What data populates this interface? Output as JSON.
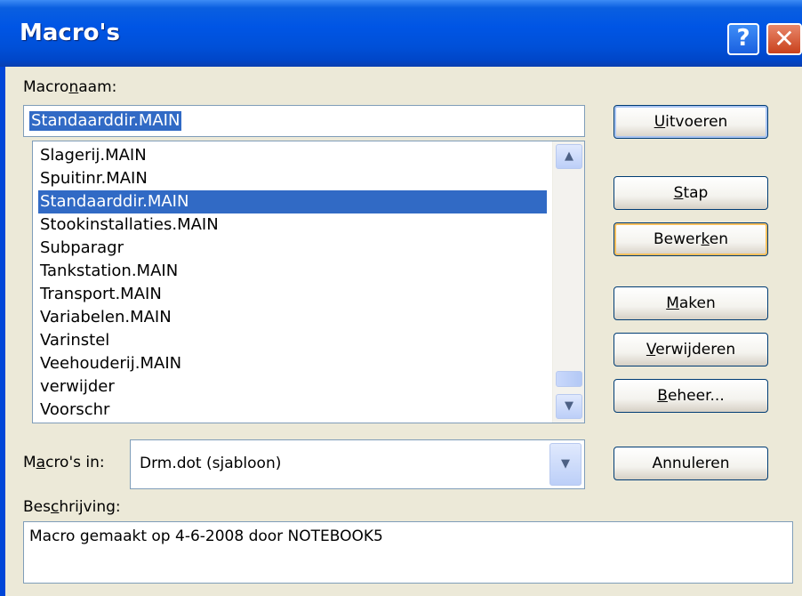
{
  "window": {
    "title": "Macro's",
    "help_label": "?",
    "close_label": "✕"
  },
  "macro_name": {
    "label_pre": "Macro",
    "label_u": "n",
    "label_post": "aam:",
    "value": "Standaarddir.MAIN"
  },
  "list": {
    "items": [
      {
        "label": "Slagerij.MAIN",
        "selected": false
      },
      {
        "label": "Spuitinr.MAIN",
        "selected": false
      },
      {
        "label": "Standaarddir.MAIN",
        "selected": true
      },
      {
        "label": "Stookinstallaties.MAIN",
        "selected": false
      },
      {
        "label": "Subparagr",
        "selected": false
      },
      {
        "label": "Tankstation.MAIN",
        "selected": false
      },
      {
        "label": "Transport.MAIN",
        "selected": false
      },
      {
        "label": "Variabelen.MAIN",
        "selected": false
      },
      {
        "label": "Varinstel",
        "selected": false
      },
      {
        "label": "Veehouderij.MAIN",
        "selected": false
      },
      {
        "label": "verwijder",
        "selected": false
      },
      {
        "label": "Voorschr",
        "selected": false
      }
    ],
    "up_arrow": "▲",
    "down_arrow": "▼"
  },
  "buttons": {
    "run": {
      "u": "U",
      "rest": "itvoeren"
    },
    "step": {
      "u": "S",
      "rest": "tap"
    },
    "edit": {
      "pre": "Bewer",
      "u": "k",
      "rest": "en"
    },
    "create": {
      "u": "M",
      "rest": "aken"
    },
    "delete": {
      "u": "V",
      "rest": "erwijderen"
    },
    "organize": {
      "u": "B",
      "rest": "eheer..."
    },
    "cancel": "Annuleren"
  },
  "macros_in": {
    "label_pre": "M",
    "label_u": "a",
    "label_post": "cro's in:",
    "value": "Drm.dot (sjabloon)",
    "arrow": "▼"
  },
  "description": {
    "label_pre": "Bes",
    "label_u": "c",
    "label_post": "hrijving:",
    "value": "Macro gemaakt op 4-6-2008 door NOTEBOOK5"
  }
}
